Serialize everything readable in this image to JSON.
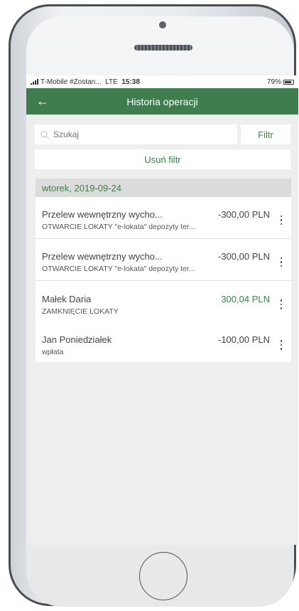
{
  "status_bar": {
    "carrier": "T-Mobile #Zostan...",
    "network": "LTE",
    "time": "15:38",
    "battery": "79%"
  },
  "app_bar": {
    "back_icon": "back-arrow-icon",
    "title": "Historia operacji"
  },
  "search": {
    "placeholder": "Szukaj",
    "filter_label": "Filtr",
    "clear_filter_label": "Usuń filtr"
  },
  "date_header": "wtorek, 2019-09-24",
  "transactions": [
    {
      "title": "Przelew wewnętrzny wycho...",
      "amount": "-300,00 PLN",
      "description": "OTWARCIE LOKATY \"e-lokata\" depozyty ter..."
    },
    {
      "title": "Przelew wewnętrzny wycho...",
      "amount": "-300,00 PLN",
      "description": "OTWARCIE LOKATY \"e-lokata\" depozyty ter..."
    },
    {
      "title": "Małek Daria",
      "amount": "300,04 PLN",
      "description": "ZAMKNIĘCIE LOKATY"
    },
    {
      "title": "Jan Poniedziałek",
      "amount": "-100,00 PLN",
      "description": "wpłata"
    }
  ],
  "colors": {
    "primary": "#3f7d4e",
    "positive_amount": "#3f7d4e",
    "background": "#eeeeee"
  }
}
